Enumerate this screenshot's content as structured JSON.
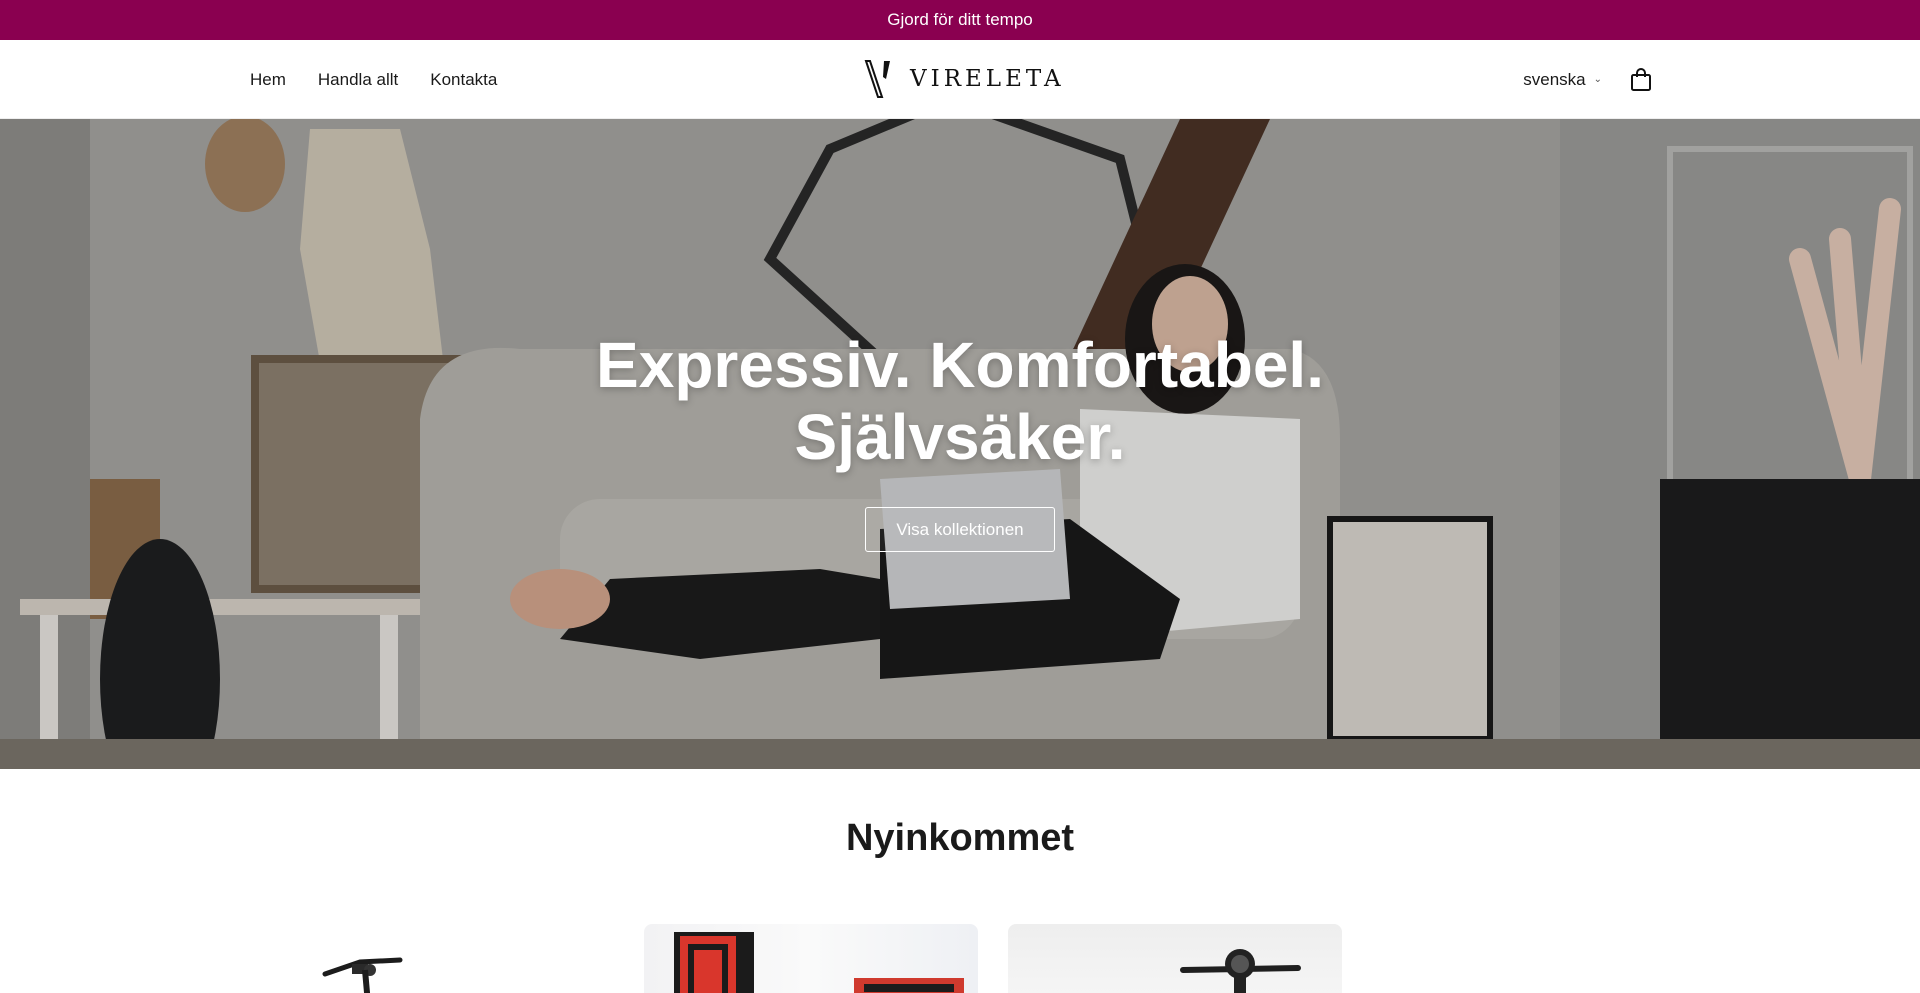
{
  "announcement": {
    "text": "Gjord för ditt tempo"
  },
  "header": {
    "nav": [
      {
        "label": "Hem"
      },
      {
        "label": "Handla allt"
      },
      {
        "label": "Kontakta"
      }
    ],
    "logo_text": "VIRELETA",
    "language": "svenska",
    "icons": {
      "cart": "shopping-bag-icon",
      "language_dropdown": "chevron-down-icon"
    }
  },
  "hero": {
    "title_line1": "Expressiv. Komfortabel.",
    "title_line2": "Självsäker.",
    "button_label": "Visa kollektionen"
  },
  "new_arrivals": {
    "title": "Nyinkommet",
    "products": [
      {
        "image": "electric-scooter-black"
      },
      {
        "image": "red-black-scooter-frame"
      },
      {
        "image": "electric-scooter-handlebar"
      }
    ]
  },
  "colors": {
    "announcement_bg": "#8a0050",
    "text": "#1a1a1a",
    "hero_text": "#ffffff"
  }
}
